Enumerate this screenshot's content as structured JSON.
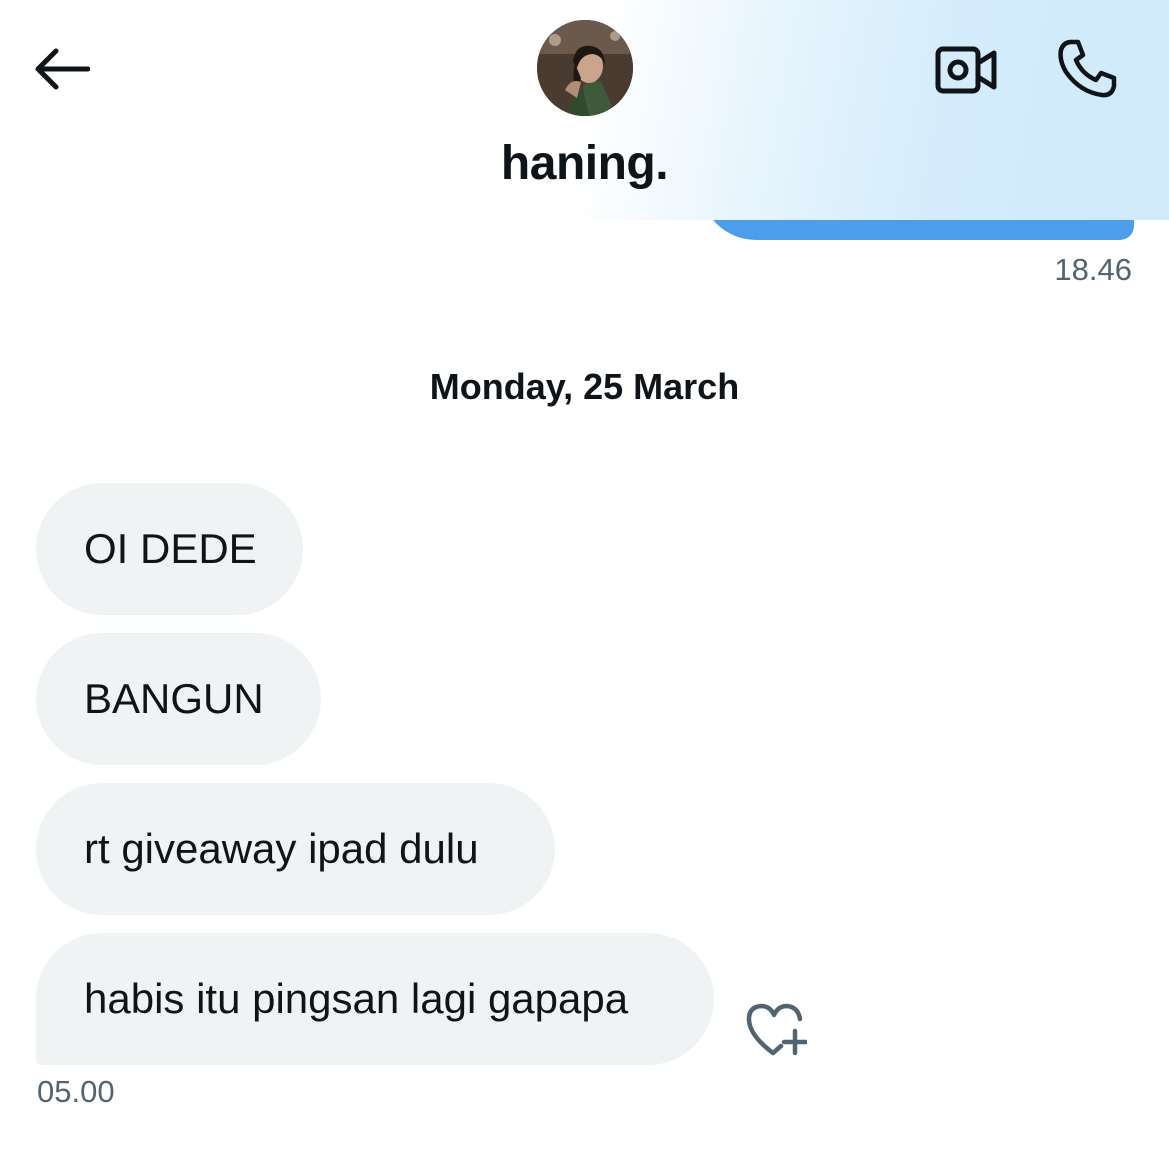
{
  "header": {
    "back_icon": "arrow-left-icon",
    "contact_name": "haning.",
    "video_icon": "video-camera-icon",
    "call_icon": "phone-icon"
  },
  "colors": {
    "outgoing_bubble": "#4c9eeb",
    "incoming_bubble": "#eff3f4",
    "timestamp": "#536471",
    "text": "#0f1419"
  },
  "outgoing": {
    "timestamp": "18.46"
  },
  "date_separator": "Monday, 25 March",
  "incoming": {
    "messages": [
      {
        "text": "OI DEDE"
      },
      {
        "text": "BANGUN"
      },
      {
        "text": "rt giveaway ipad dulu"
      },
      {
        "text": "habis itu pingsan lagi gapapa"
      }
    ],
    "timestamp": "05.00",
    "reaction_icon": "heart-plus-icon"
  }
}
